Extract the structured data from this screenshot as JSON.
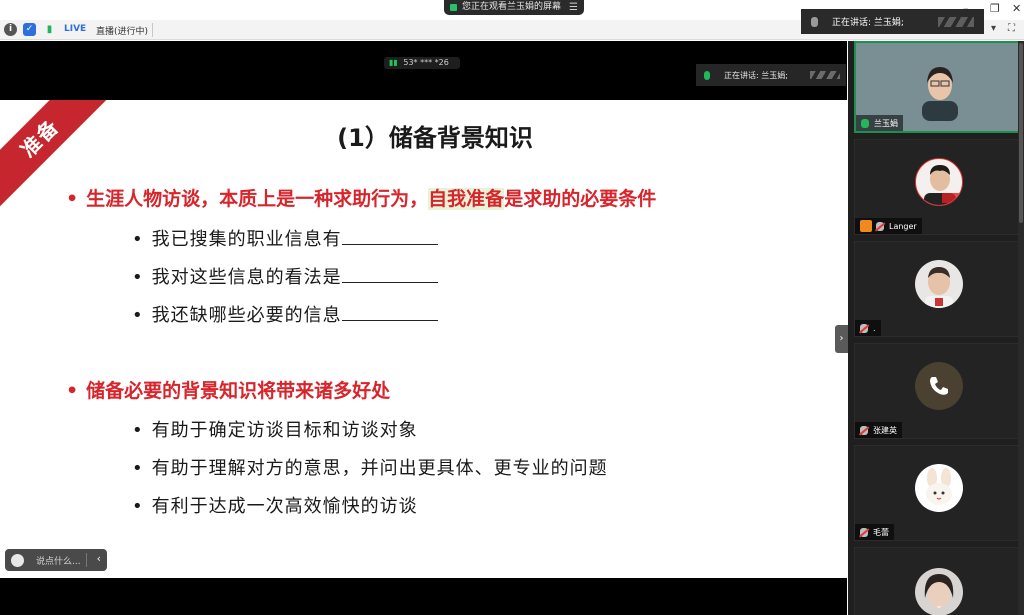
{
  "window": {
    "share_notice": "您正在观看兰玉娟的屏幕",
    "menu_icon": "hamburger-icon",
    "minimize": "–",
    "restore": "❐",
    "close": "✕"
  },
  "status_bar": {
    "live_badge": "LIVE",
    "live_status": "直播(进行中)",
    "icons": [
      "info-icon",
      "shield-icon",
      "signal-bars-icon"
    ]
  },
  "speaking_banner": {
    "label": "正在讲话: 兰玉娟;"
  },
  "video": {
    "signal_text": "53* *** *26",
    "inner_speaking": "正在讲话: 兰玉娟;"
  },
  "slide": {
    "ribbon": "准备",
    "title": "(1）储备背景知识",
    "bullet1_part1": "生涯人物访谈，本质上是一种求助行为，",
    "bullet1_highlight": "自我准备",
    "bullet1_part2": "是求助的必要条件",
    "sub1": [
      "我已搜集的职业信息有",
      "我对这些信息的看法是",
      "我还缺哪些必要的信息"
    ],
    "bullet2": "储备必要的背景知识将带来诸多好处",
    "sub2": [
      "有助于确定访谈目标和访谈对象",
      "有助于理解对方的意思，并问出更具体、更专业的问题",
      "有利于达成一次高效愉快的访谈"
    ],
    "bullet_char": "•"
  },
  "chat": {
    "placeholder": "说点什么..."
  },
  "participants": [
    {
      "name": "兰玉娟",
      "mic": "on"
    },
    {
      "name": "Langer",
      "mic": "muted",
      "host": true
    },
    {
      "name": ".",
      "mic": "muted"
    },
    {
      "name": "张建英",
      "mic": "muted"
    },
    {
      "name": "毛蕾",
      "mic": "muted"
    },
    {
      "name": "",
      "mic": "muted"
    }
  ],
  "colors": {
    "accent_red": "#d8252c",
    "highlight_green": "#e7f3d8",
    "speaking_green": "#1f8f4f"
  }
}
